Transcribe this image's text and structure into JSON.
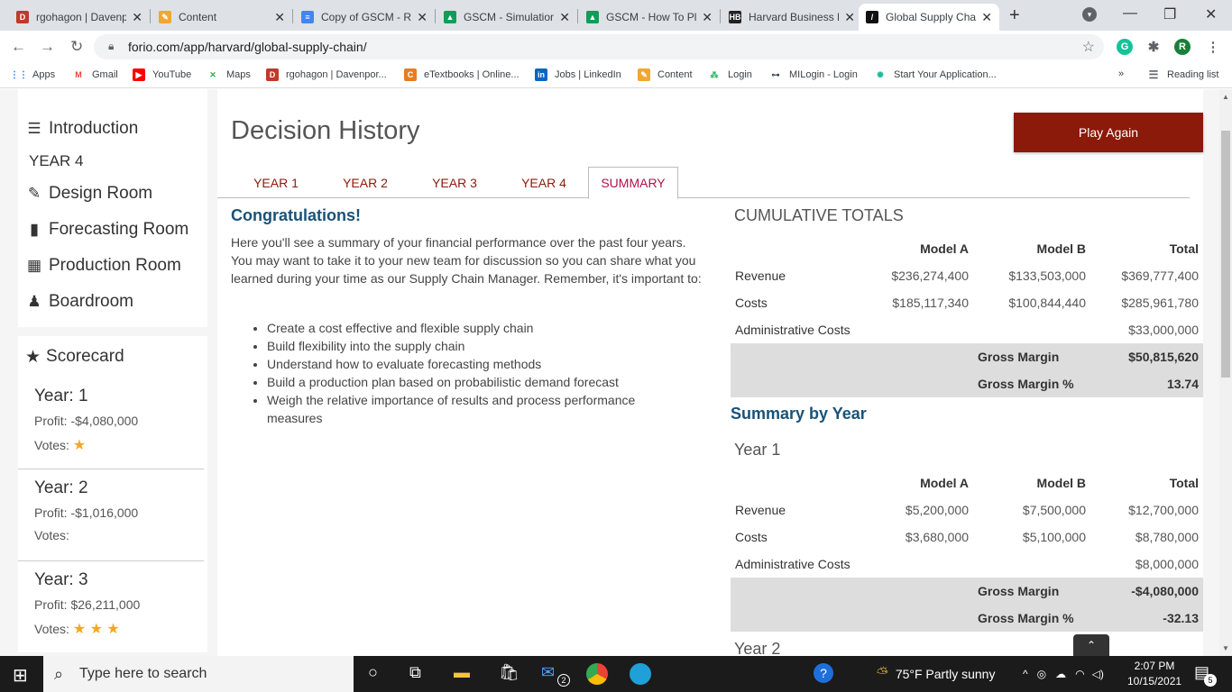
{
  "browser": {
    "tabs": [
      {
        "title": "rgohagon | Davenp",
        "fav": "D",
        "color": "#c0392b"
      },
      {
        "title": "Content",
        "fav": "✎",
        "color": "#f0a830"
      },
      {
        "title": "Copy of GSCM - Re",
        "fav": "≡",
        "color": "#4285f4"
      },
      {
        "title": "GSCM - Simulation",
        "fav": "▲",
        "color": "#0f9d58"
      },
      {
        "title": "GSCM - How To Pla",
        "fav": "▲",
        "color": "#0f9d58"
      },
      {
        "title": "Harvard Business P",
        "fav": "HB",
        "color": "#222"
      },
      {
        "title": "Global Supply Chai",
        "fav": "/",
        "color": "#111"
      }
    ],
    "url": "forio.com/app/harvard/global-supply-chain/",
    "bookmarks": [
      {
        "label": "Apps",
        "icon": "⋮⋮",
        "color": "#1a73e8"
      },
      {
        "label": "Gmail",
        "icon": "M",
        "color": "#ea4335"
      },
      {
        "label": "YouTube",
        "icon": "▶",
        "color": "#ff0000"
      },
      {
        "label": "Maps",
        "icon": "✕",
        "color": "#34a853"
      },
      {
        "label": "rgohagon | Davenpor...",
        "icon": "D",
        "color": "#c0392b"
      },
      {
        "label": "eTextbooks | Online...",
        "icon": "C",
        "color": "#e67e22"
      },
      {
        "label": "Jobs | LinkedIn",
        "icon": "in",
        "color": "#0a66c2"
      },
      {
        "label": "Content",
        "icon": "✎",
        "color": "#f0a830"
      },
      {
        "label": "Login",
        "icon": "⁂",
        "color": "#27ae60"
      },
      {
        "label": "MILogin - Login",
        "icon": "⊶",
        "color": "#2c3e50"
      },
      {
        "label": "Start Your Application...",
        "icon": "✺",
        "color": "#1abc9c"
      }
    ],
    "reading_list": "Reading list",
    "profile_initial": "R"
  },
  "sidebar": {
    "intro": "Introduction",
    "year_label": "YEAR 4",
    "rooms": [
      "Design Room",
      "Forecasting Room",
      "Production Room",
      "Boardroom"
    ],
    "scorecard_label": "Scorecard",
    "years": [
      {
        "title": "Year: 1",
        "profit": "Profit: -$4,080,000",
        "votes_label": "Votes:",
        "stars": "★"
      },
      {
        "title": "Year: 2",
        "profit": "Profit: -$1,016,000",
        "votes_label": "Votes:",
        "stars": ""
      },
      {
        "title": "Year: 3",
        "profit": "Profit: $26,211,000",
        "votes_label": "Votes:",
        "stars": "★ ★ ★"
      }
    ]
  },
  "main": {
    "title": "Decision History",
    "play_again": "Play Again",
    "tabs": [
      "YEAR 1",
      "YEAR 2",
      "YEAR 3",
      "YEAR 4",
      "SUMMARY"
    ],
    "congrats": "Congratulations!",
    "intro": "Here you'll see a summary of your financial performance over the past four years. You may want to take it to your new team for discussion so you can share what you learned during your time as our Supply Chain Manager. Remember, it's important to:",
    "bullets": [
      "Create a cost effective and flexible supply chain",
      "Build flexibility into the supply chain",
      "Understand how to evaluate forecasting methods",
      "Build a production plan based on probabilistic demand forecast",
      "Weigh the relative importance of results and process performance measures"
    ]
  },
  "cumulative": {
    "heading": "CUMULATIVE TOTALS",
    "cols": [
      "Model A",
      "Model B",
      "Total"
    ],
    "revenue": {
      "label": "Revenue",
      "a": "$236,274,400",
      "b": "$133,503,000",
      "t": "$369,777,400"
    },
    "costs": {
      "label": "Costs",
      "a": "$185,117,340",
      "b": "$100,844,440",
      "t": "$285,961,780"
    },
    "admin": {
      "label": "Administrative Costs",
      "t": "$33,000,000"
    },
    "gm": {
      "label": "Gross Margin",
      "t": "$50,815,620"
    },
    "gmp": {
      "label": "Gross Margin %",
      "t": "13.74"
    }
  },
  "summary_by_year": {
    "heading": "Summary by Year",
    "year1": {
      "title": "Year 1",
      "cols": [
        "Model A",
        "Model B",
        "Total"
      ],
      "revenue": {
        "label": "Revenue",
        "a": "$5,200,000",
        "b": "$7,500,000",
        "t": "$12,700,000"
      },
      "costs": {
        "label": "Costs",
        "a": "$3,680,000",
        "b": "$5,100,000",
        "t": "$8,780,000"
      },
      "admin": {
        "label": "Administrative Costs",
        "t": "$8,000,000"
      },
      "gm": {
        "label": "Gross Margin",
        "t": "-$4,080,000"
      },
      "gmp": {
        "label": "Gross Margin %",
        "t": "-32.13"
      }
    },
    "year2_title": "Year 2"
  },
  "taskbar": {
    "search_placeholder": "Type here to search",
    "weather": "75°F  Partly sunny",
    "time": "2:07 PM",
    "date": "10/15/2021",
    "mail_badge": "2",
    "notif_count": "5"
  }
}
